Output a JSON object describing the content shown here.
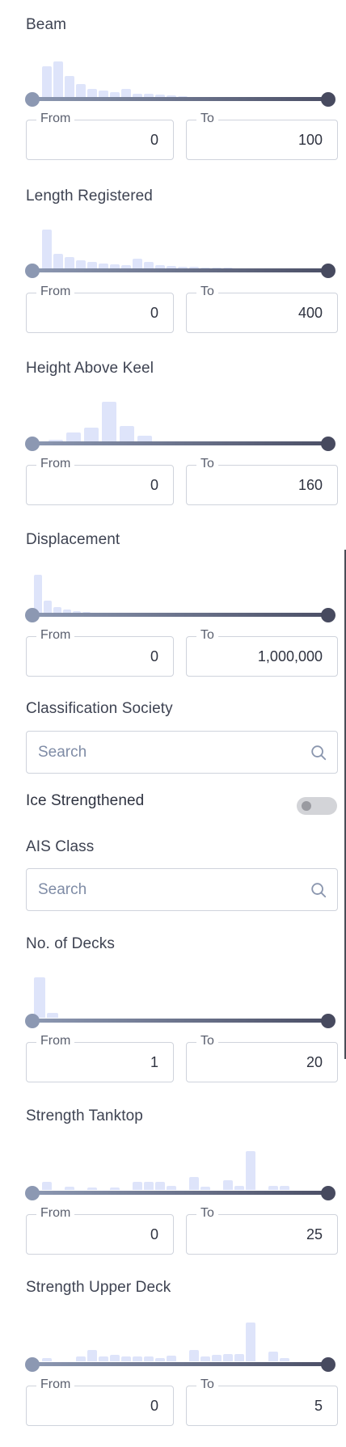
{
  "filters": {
    "beam": {
      "label": "Beam",
      "from_label": "From",
      "from_value": "0",
      "to_label": "To",
      "to_value": "100"
    },
    "length_registered": {
      "label": "Length Registered",
      "from_label": "From",
      "from_value": "0",
      "to_label": "To",
      "to_value": "400"
    },
    "height_above_keel": {
      "label": "Height Above Keel",
      "from_label": "From",
      "from_value": "0",
      "to_label": "To",
      "to_value": "160"
    },
    "displacement": {
      "label": "Displacement",
      "from_label": "From",
      "from_value": "0",
      "to_label": "To",
      "to_value": "1,000,000"
    },
    "classification_society": {
      "label": "Classification Society",
      "placeholder": "Search"
    },
    "ice_strengthened": {
      "label": "Ice Strengthened",
      "enabled": false
    },
    "ais_class": {
      "label": "AIS Class",
      "placeholder": "Search"
    },
    "no_of_decks": {
      "label": "No. of Decks",
      "from_label": "From",
      "from_value": "1",
      "to_label": "To",
      "to_value": "20"
    },
    "strength_tanktop": {
      "label": "Strength Tanktop",
      "from_label": "From",
      "from_value": "0",
      "to_label": "To",
      "to_value": "25"
    },
    "strength_upper_deck": {
      "label": "Strength Upper Deck",
      "from_label": "From",
      "from_value": "0",
      "to_label": "To",
      "to_value": "5"
    }
  },
  "colors": {
    "histogram_bar": "#dee4fa",
    "slider_start": "#8c98b2",
    "slider_end": "#474a5f",
    "input_border": "#cfd3dc",
    "placeholder": "#7f8ca6"
  },
  "icons": {
    "search": "search-icon"
  }
}
